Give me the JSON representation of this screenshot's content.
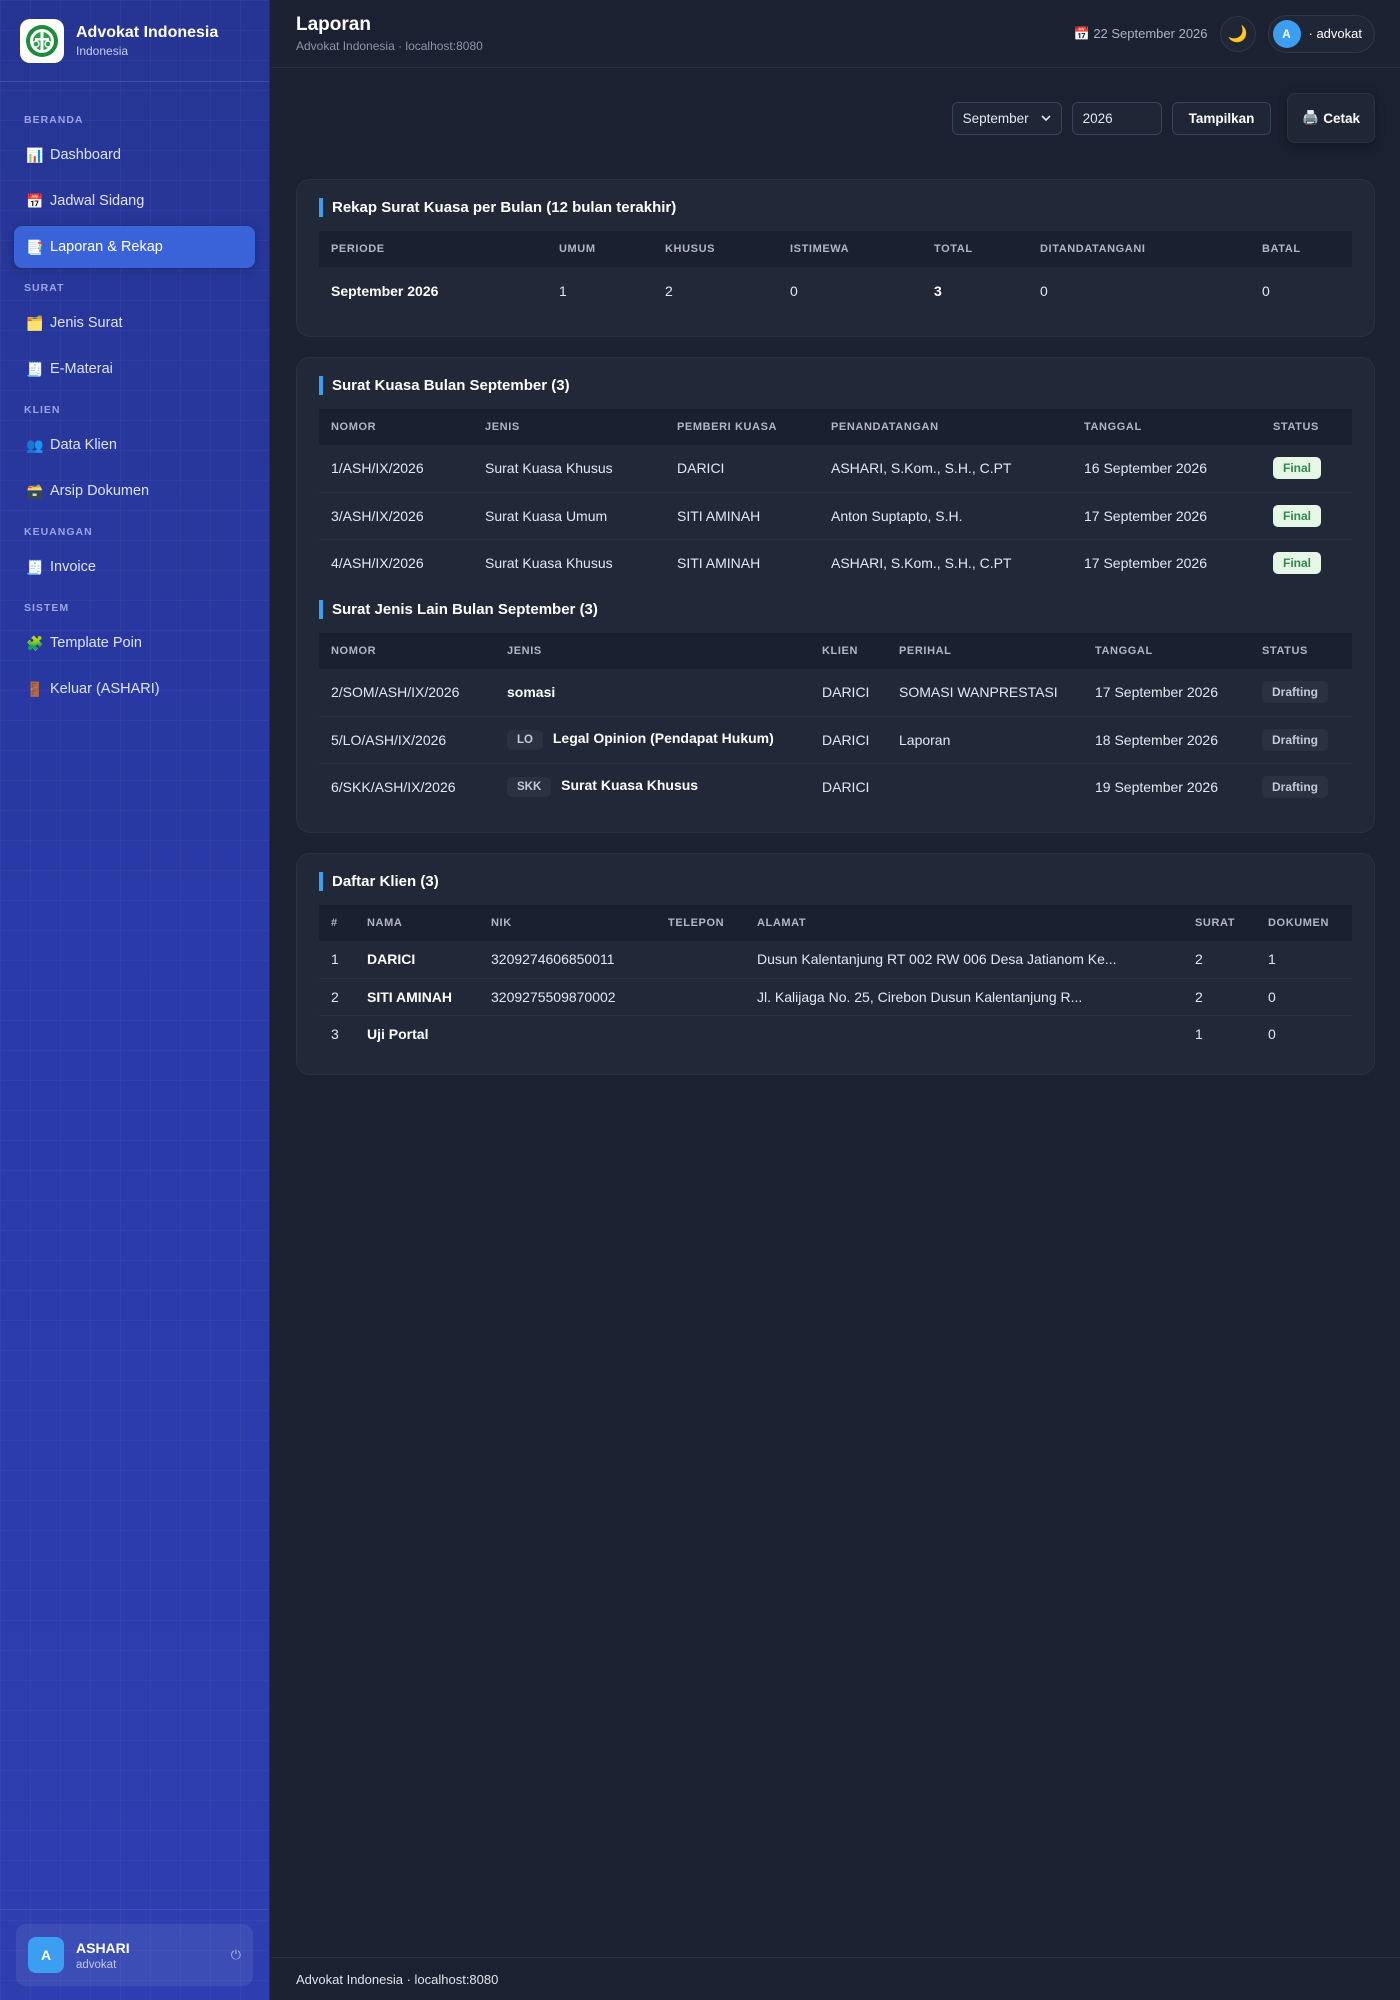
{
  "brand": {
    "name": "Advokat Indonesia",
    "sub": "Indonesia"
  },
  "sidebar": {
    "sections": {
      "beranda": "BERANDA",
      "surat": "SURAT",
      "klien": "KLIEN",
      "keuangan": "KEUANGAN",
      "sistem": "SISTEM"
    },
    "items": {
      "dashboard": {
        "icon": "📊",
        "label": "Dashboard"
      },
      "jadwal": {
        "icon": "📅",
        "label": "Jadwal Sidang"
      },
      "laporan": {
        "icon": "📑",
        "label": "Laporan & Rekap"
      },
      "jenis_surat": {
        "icon": "🗂️",
        "label": "Jenis Surat"
      },
      "ematerai": {
        "icon": "🧾",
        "label": "E-Materai"
      },
      "data_klien": {
        "icon": "👥",
        "label": "Data Klien"
      },
      "arsip": {
        "icon": "🗃️",
        "label": "Arsip Dokumen"
      },
      "invoice": {
        "icon": "🧾",
        "label": "Invoice"
      },
      "template": {
        "icon": "🧩",
        "label": "Template Poin"
      },
      "keluar": {
        "icon": "🚪",
        "label": "Keluar (ASHARI)"
      }
    },
    "user": {
      "initial": "A",
      "name": "ASHARI",
      "role": "advokat",
      "power_icon": "⏻"
    }
  },
  "header": {
    "title": "Laporan",
    "subtitle": "Advokat Indonesia · localhost:8080",
    "date_icon": "📅",
    "date": "22 September 2026",
    "theme_icon": "🌙",
    "user_initial": "A",
    "user_label": "· advokat"
  },
  "toolbar": {
    "month": "September",
    "year": "2026",
    "show_label": "Tampilkan",
    "print_icon": "🖨️",
    "print_label": "Cetak"
  },
  "rekap": {
    "title": "Rekap Surat Kuasa per Bulan (12 bulan terakhir)",
    "headers": [
      "PERIODE",
      "UMUM",
      "KHUSUS",
      "ISTIMEWA",
      "TOTAL",
      "DITANDATANGANI",
      "BATAL"
    ],
    "row": {
      "periode": "September 2026",
      "umum": "1",
      "khusus": "2",
      "istimewa": "0",
      "total": "3",
      "ditandatangani": "0",
      "batal": "0"
    }
  },
  "kuasa": {
    "title": "Surat Kuasa Bulan September (3)",
    "headers": [
      "NOMOR",
      "JENIS",
      "PEMBERI KUASA",
      "PENANDATANGAN",
      "TANGGAL",
      "STATUS"
    ],
    "rows": [
      {
        "nomor": "1/ASH/IX/2026",
        "jenis": "Surat Kuasa Khusus",
        "pemberi": "DARICI",
        "penandatangan": "ASHARI, S.Kom., S.H., C.PT",
        "tanggal": "16 September 2026",
        "status": "Final"
      },
      {
        "nomor": "3/ASH/IX/2026",
        "jenis": "Surat Kuasa Umum",
        "pemberi": "SITI AMINAH",
        "penandatangan": "Anton Suptapto, S.H.",
        "tanggal": "17 September 2026",
        "status": "Final"
      },
      {
        "nomor": "4/ASH/IX/2026",
        "jenis": "Surat Kuasa Khusus",
        "pemberi": "SITI AMINAH",
        "penandatangan": "ASHARI, S.Kom., S.H., C.PT",
        "tanggal": "17 September 2026",
        "status": "Final"
      }
    ]
  },
  "lain": {
    "title": "Surat Jenis Lain Bulan September (3)",
    "headers": [
      "NOMOR",
      "JENIS",
      "KLIEN",
      "PERIHAL",
      "TANGGAL",
      "STATUS"
    ],
    "rows": [
      {
        "nomor": "2/SOM/ASH/IX/2026",
        "code": "",
        "jenis": "somasi",
        "klien": "DARICI",
        "perihal": "SOMASI WANPRESTASI",
        "tanggal": "17 September 2026",
        "status": "Drafting"
      },
      {
        "nomor": "5/LO/ASH/IX/2026",
        "code": "LO",
        "jenis": "Legal Opinion (Pendapat Hukum)",
        "klien": "DARICI",
        "perihal": "Laporan",
        "tanggal": "18 September 2026",
        "status": "Drafting"
      },
      {
        "nomor": "6/SKK/ASH/IX/2026",
        "code": "SKK",
        "jenis": "Surat Kuasa Khusus",
        "klien": "DARICI",
        "perihal": "",
        "tanggal": "19 September 2026",
        "status": "Drafting"
      }
    ]
  },
  "klien": {
    "title": "Daftar Klien (3)",
    "headers": [
      "#",
      "NAMA",
      "NIK",
      "TELEPON",
      "ALAMAT",
      "SURAT",
      "DOKUMEN"
    ],
    "rows": [
      {
        "no": "1",
        "nama": "DARICI",
        "nik": "3209274606850011",
        "telepon": "",
        "alamat": "Dusun Kalentanjung RT 002 RW 006 Desa Jatianom Ke...",
        "surat": "2",
        "dokumen": "1"
      },
      {
        "no": "2",
        "nama": "SITI AMINAH",
        "nik": "3209275509870002",
        "telepon": "",
        "alamat": "Jl. Kalijaga No. 25, Cirebon Dusun Kalentanjung R...",
        "surat": "2",
        "dokumen": "0"
      },
      {
        "no": "3",
        "nama": "Uji Portal",
        "nik": "",
        "telepon": "",
        "alamat": "",
        "surat": "1",
        "dokumen": "0"
      }
    ]
  },
  "footer": {
    "text": "Advokat Indonesia · localhost:8080"
  }
}
